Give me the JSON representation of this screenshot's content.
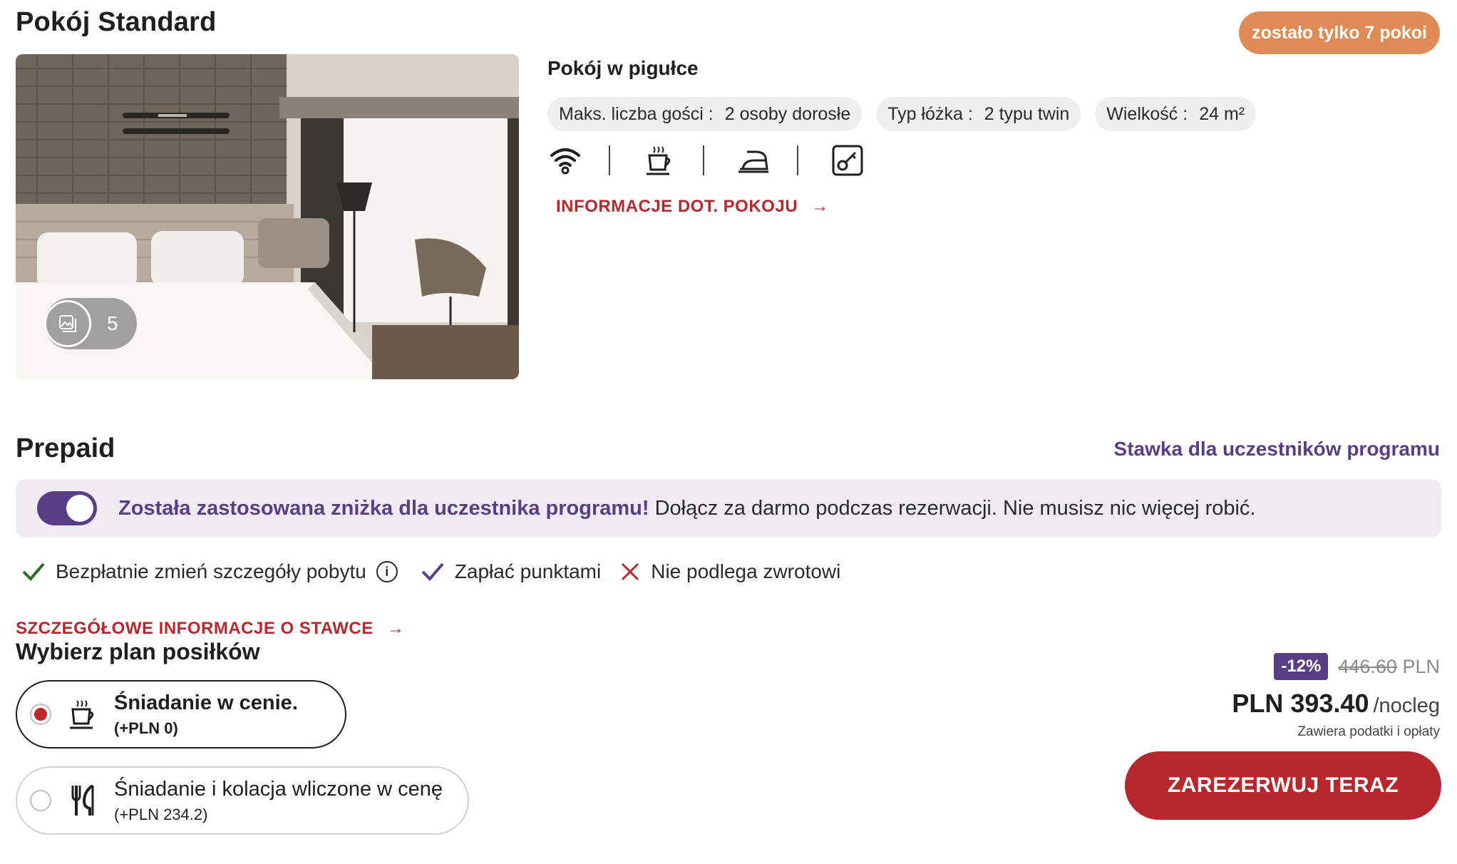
{
  "room": {
    "title": "Pokój Standard",
    "rooms_left_badge": "zostało tylko 7 pokoi",
    "gallery_count": "5",
    "summary_title": "Pokój w pigułce",
    "chips": [
      {
        "label": "Maks. liczba gości :",
        "value": "2 osoby dorosłe"
      },
      {
        "label": "Typ łóżka :",
        "value": "2 typu twin"
      },
      {
        "label": "Wielkość :",
        "value": "24 m²"
      }
    ],
    "amenity_icons": [
      "wifi-icon",
      "coffee-icon",
      "iron-icon",
      "key-card-icon"
    ],
    "info_link": "INFORMACJE DOT. POKOJU",
    "link_arrow": "→"
  },
  "rate": {
    "title": "Prepaid",
    "member_rate": "Stawka dla uczestników programu",
    "banner_bold": "Została zastosowana zniżka dla uczestnika programu!",
    "banner_text": " Dołącz za darmo podczas rezerwacji. Nie musisz nic więcej robić.",
    "features": [
      {
        "icon": "check-icon",
        "label": "Bezpłatnie zmień szczegóły pobytu",
        "color": "#2f6a2a"
      },
      {
        "icon": "check-icon",
        "label": "Zapłać punktami",
        "color": "#5a3e85"
      },
      {
        "icon": "cross-icon",
        "label": "Nie podlega zwrotowi",
        "color": "#c0262d"
      }
    ],
    "info_glyph": "i",
    "details_link": "SZCZEGÓŁOWE INFORMACJE O STAWCE"
  },
  "meals": {
    "title": "Wybierz plan posiłków",
    "options": [
      {
        "name": "Śniadanie w cenie.",
        "price": "(+PLN 0)",
        "selected": true,
        "icon": "coffee-icon"
      },
      {
        "name": "Śniadanie i kolacja wliczone w cenę",
        "price": "(+PLN 234.2)",
        "selected": false,
        "icon": "cutlery-icon"
      }
    ]
  },
  "price": {
    "discount": "-12%",
    "old_price": "446.60",
    "old_currency": "PLN",
    "current": "PLN 393.40",
    "per": "/nocleg",
    "taxes": "Zawiera podatki i opłaty",
    "book_button": "ZAREZERWUJ TERAZ"
  },
  "colors": {
    "accent_red": "#b7282e",
    "member_purple": "#5a3e85",
    "badge_orange": "#e08a55"
  }
}
